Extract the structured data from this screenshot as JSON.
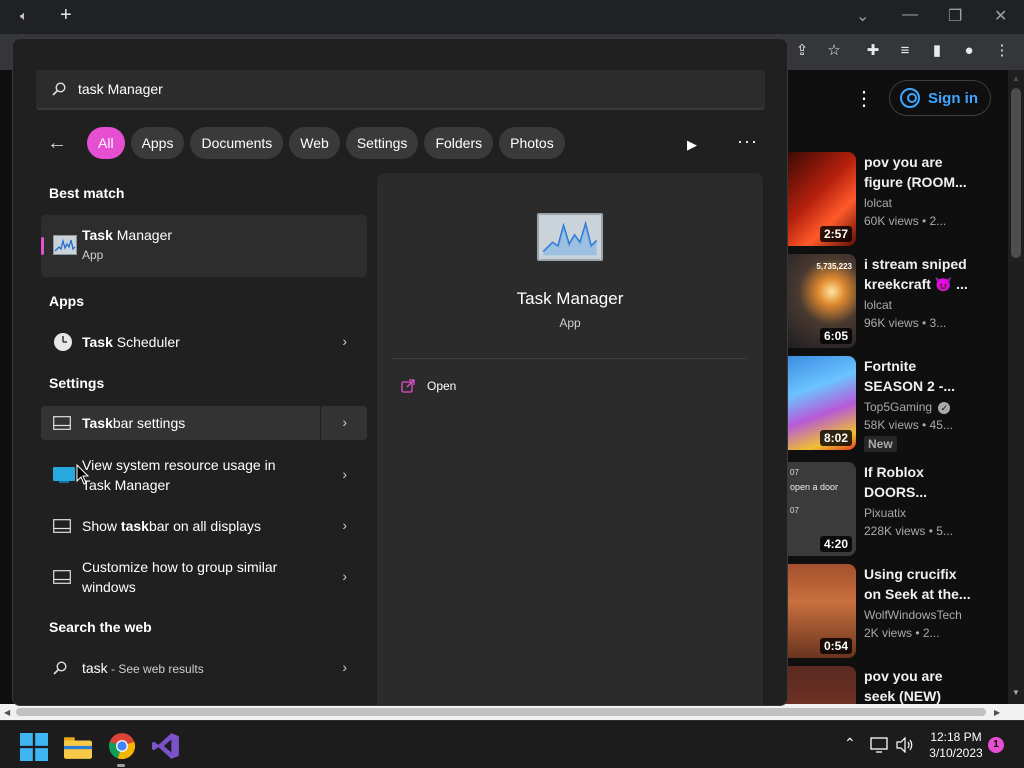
{
  "browser": {
    "new_tab_symbol": "+",
    "window_controls": [
      "⌄",
      "—",
      "❐",
      "✕"
    ]
  },
  "youtube": {
    "sign_in_label": "Sign in",
    "videos": [
      {
        "title": "pov you are figure (ROOM...",
        "channel": "lolcat",
        "meta": "60K views • 2...",
        "duration": "2:57",
        "badge": ""
      },
      {
        "title": "i stream sniped kreekcraft 😈 ...",
        "channel": "lolcat",
        "meta": "96K views • 3...",
        "duration": "6:05",
        "badge": ""
      },
      {
        "title": "Fortnite SEASON 2 -...",
        "channel": "Top5Gaming",
        "meta": "58K views • 45...",
        "duration": "8:02",
        "badge": "New"
      },
      {
        "title": "If Roblox DOORS...",
        "channel": "Pixuatix",
        "meta": "228K views • 5...",
        "duration": "4:20",
        "badge": ""
      },
      {
        "title": "Using crucifix on Seek at the...",
        "channel": "WolfWindowsTech",
        "meta": "2K views • 2...",
        "duration": "0:54",
        "badge": ""
      },
      {
        "title": "pov you are seek (NEW)",
        "channel": "",
        "meta": "",
        "duration": "",
        "badge": ""
      }
    ],
    "thumb_texts": {
      "count": "5,735,223",
      "door1": "07",
      "door2": "open a door",
      "door3": "07"
    }
  },
  "search": {
    "query": "task Manager",
    "filters": [
      "All",
      "Apps",
      "Documents",
      "Web",
      "Settings",
      "Folders",
      "Photos"
    ],
    "active_filter": "All",
    "best_match_heading": "Best match",
    "best_match": {
      "bold": "Task",
      "rest": " Manager",
      "subtitle": "App"
    },
    "apps_heading": "Apps",
    "apps": [
      {
        "bold": "Task",
        "rest": " Scheduler"
      }
    ],
    "settings_heading": "Settings",
    "settings": [
      {
        "bold": "Task",
        "rest": "bar settings"
      },
      {
        "line1": "View system resource usage in",
        "line2": "Task Manager"
      },
      {
        "pre": "Show ",
        "bold": "task",
        "rest": "bar on all displays"
      },
      {
        "line1": "Customize how to group similar",
        "line2": "windows"
      }
    ],
    "web_heading": "Search the web",
    "web": {
      "query": "task",
      "suffix": " - See web results"
    },
    "preview": {
      "title": "Task Manager",
      "subtitle": "App",
      "action": "Open"
    }
  },
  "taskbar": {
    "time": "12:18 PM",
    "date": "3/10/2023",
    "notification_count": "1"
  },
  "colors": {
    "accent": "#e64fd1",
    "yt_link": "#3ea6ff"
  }
}
